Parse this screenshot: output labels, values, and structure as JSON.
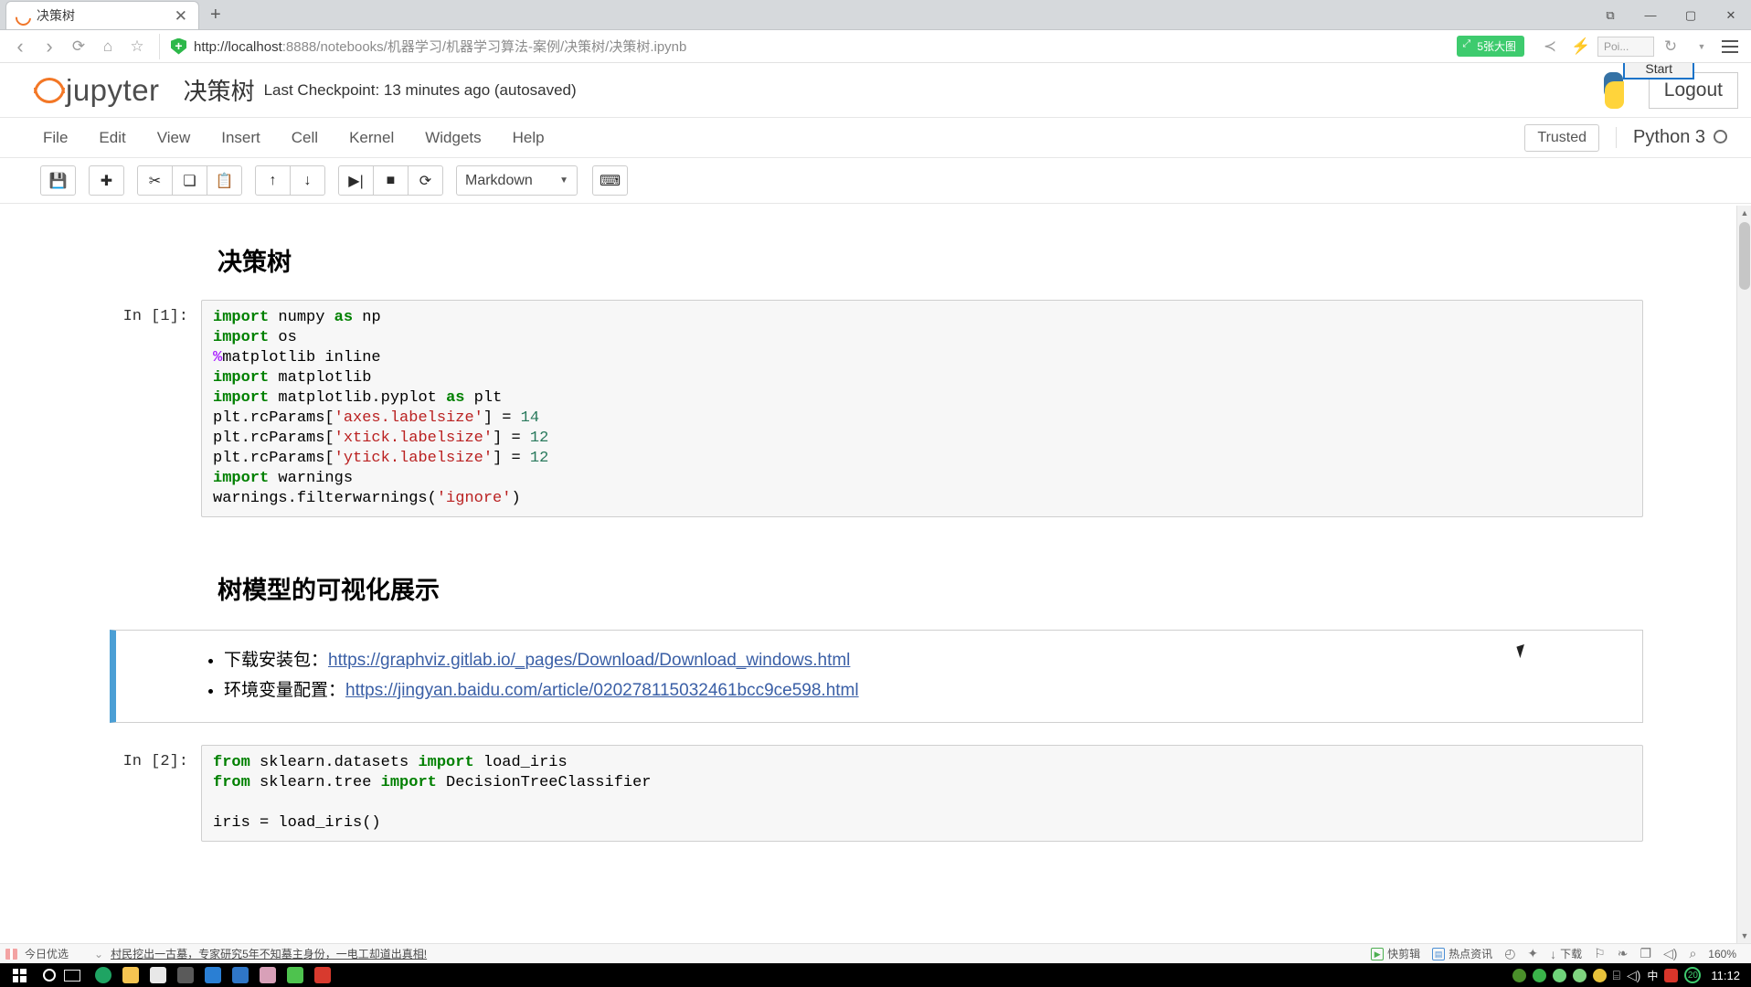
{
  "browser": {
    "tab": {
      "title": "决策树",
      "close_label": "✕",
      "favicon": "jupyter-favicon"
    },
    "new_tab_label": "+",
    "window_controls": [
      {
        "name": "restore-session-button",
        "glyph": "⧉"
      },
      {
        "name": "minimize-button",
        "glyph": "—"
      },
      {
        "name": "maximize-button",
        "glyph": "▢"
      },
      {
        "name": "close-button",
        "glyph": "✕"
      }
    ],
    "nav": {
      "back": "‹",
      "forward": "›",
      "reload": "⟳",
      "home": "⌂",
      "bookmark": "☆"
    },
    "url_protocol": "http://",
    "url_host": "localhost",
    "url_path": ":8888/notebooks/机器学习/机器学习算法-案例/决策树/决策树.ipynb",
    "url_full": "http://localhost:8888/notebooks/机器学习/机器学习算法-案例/决策树/决策树.ipynb",
    "image_badge": "5张大图",
    "share_icon": "≺",
    "bolt_icon": "⚡",
    "poi_box_text": "Poi...",
    "history_icon": "↻",
    "menu_icon": "hamburger-menu"
  },
  "jupyter": {
    "logo_text": "jupyter",
    "notebook_name": "决策树",
    "checkpoint": "Last Checkpoint: 13 minutes ago (autosaved)",
    "start_tooltip": "Start",
    "logout_label": "Logout",
    "trusted_label": "Trusted",
    "kernel_label": "Python 3",
    "menus": [
      {
        "label": "File"
      },
      {
        "label": "Edit"
      },
      {
        "label": "View"
      },
      {
        "label": "Insert"
      },
      {
        "label": "Cell"
      },
      {
        "label": "Kernel"
      },
      {
        "label": "Widgets"
      },
      {
        "label": "Help"
      }
    ],
    "toolbar": {
      "save": "💾",
      "insert_below": "✚",
      "cut": "✂",
      "copy": "❏",
      "paste": "📋",
      "move_up": "↑",
      "move_down": "↓",
      "run": "▶|",
      "stop": "■",
      "restart": "⟳",
      "cell_type": "Markdown",
      "cell_type_caret": "▼",
      "command_palette": "⌨"
    }
  },
  "notebook": {
    "heading_1": "决策树",
    "heading_2": "树模型的可视化展示",
    "cell_1": {
      "prompt": "In [1]:",
      "lines": [
        [
          {
            "t": "import",
            "c": "k"
          },
          {
            "t": " numpy ",
            "c": ""
          },
          {
            "t": "as",
            "c": "k"
          },
          {
            "t": " np",
            "c": ""
          }
        ],
        [
          {
            "t": "import",
            "c": "k"
          },
          {
            "t": " os",
            "c": ""
          }
        ],
        [
          {
            "t": "%",
            "c": "m"
          },
          {
            "t": "matplotlib inline",
            "c": ""
          }
        ],
        [
          {
            "t": "import",
            "c": "k"
          },
          {
            "t": " matplotlib",
            "c": ""
          }
        ],
        [
          {
            "t": "import",
            "c": "k"
          },
          {
            "t": " matplotlib.pyplot ",
            "c": ""
          },
          {
            "t": "as",
            "c": "k"
          },
          {
            "t": " plt",
            "c": ""
          }
        ],
        [
          {
            "t": "plt.rcParams[",
            "c": ""
          },
          {
            "t": "'axes.labelsize'",
            "c": "s"
          },
          {
            "t": "] = ",
            "c": ""
          },
          {
            "t": "14",
            "c": "n"
          }
        ],
        [
          {
            "t": "plt.rcParams[",
            "c": ""
          },
          {
            "t": "'xtick.labelsize'",
            "c": "s"
          },
          {
            "t": "] = ",
            "c": ""
          },
          {
            "t": "12",
            "c": "n"
          }
        ],
        [
          {
            "t": "plt.rcParams[",
            "c": ""
          },
          {
            "t": "'ytick.labelsize'",
            "c": "s"
          },
          {
            "t": "] = ",
            "c": ""
          },
          {
            "t": "12",
            "c": "n"
          }
        ],
        [
          {
            "t": "import",
            "c": "k"
          },
          {
            "t": " warnings",
            "c": ""
          }
        ],
        [
          {
            "t": "warnings.filterwarnings(",
            "c": ""
          },
          {
            "t": "'ignore'",
            "c": "s"
          },
          {
            "t": ")",
            "c": ""
          }
        ]
      ]
    },
    "alert": {
      "items": [
        {
          "label": "下载安装包：",
          "link": "https://graphviz.gitlab.io/_pages/Download/Download_windows.html"
        },
        {
          "label": "环境变量配置：",
          "link": "https://jingyan.baidu.com/article/020278115032461bcc9ce598.html"
        }
      ]
    },
    "cell_2": {
      "prompt": "In [2]:",
      "lines": [
        [
          {
            "t": "from",
            "c": "k"
          },
          {
            "t": " sklearn.datasets ",
            "c": ""
          },
          {
            "t": "import",
            "c": "k"
          },
          {
            "t": " load_iris",
            "c": ""
          }
        ],
        [
          {
            "t": "from",
            "c": "k"
          },
          {
            "t": " sklearn.tree ",
            "c": ""
          },
          {
            "t": "import",
            "c": "k"
          },
          {
            "t": " DecisionTreeClassifier",
            "c": ""
          }
        ],
        [
          {
            "t": "",
            "c": ""
          }
        ],
        [
          {
            "t": "iris = load_iris()",
            "c": ""
          }
        ]
      ]
    }
  },
  "statusbar": {
    "gift_label": "今日优选",
    "collapse_icon": "⌄",
    "news": "村民挖出一古墓，专家研究5年不知墓主身份，一电工却道出真相!",
    "items": [
      {
        "label": "快剪辑",
        "icon": "scissors-icon"
      },
      {
        "label": "热点资讯",
        "icon": "news-icon"
      },
      {
        "label": "",
        "icon": "speedometer-icon"
      },
      {
        "label": "",
        "icon": "rocket-icon"
      },
      {
        "label": "下载",
        "icon": "download-icon"
      },
      {
        "label": "",
        "icon": "flag-icon"
      },
      {
        "label": "",
        "icon": "leaf-icon"
      },
      {
        "label": "",
        "icon": "window-icon"
      },
      {
        "label": "",
        "icon": "speaker-icon"
      },
      {
        "label": "",
        "icon": "search-icon"
      }
    ],
    "zoom": "160%"
  },
  "taskbar": {
    "start_icon": "windows-start-icon",
    "cortana_icon": "cortana-circle-icon",
    "taskview_icon": "task-view-icon",
    "apps": [
      {
        "name": "edge",
        "color": "#1fa463"
      },
      {
        "name": "file-explorer",
        "color": "#f5c451"
      },
      {
        "name": "news-app",
        "color": "#e8e8e8"
      },
      {
        "name": "terminal",
        "color": "#5a5a5a"
      },
      {
        "name": "excel-like",
        "color": "#2a7fd4"
      },
      {
        "name": "checkmark-app",
        "color": "#2f76c7"
      },
      {
        "name": "photos-app",
        "color": "#d8a0b8"
      },
      {
        "name": "wechat-app",
        "color": "#4ec34e"
      },
      {
        "name": "active-app",
        "color": "#d83a2e"
      }
    ],
    "tray": [
      {
        "name": "nvidia",
        "color": "#4a8f2a"
      },
      {
        "name": "browser-green",
        "color": "#3ab34a"
      },
      {
        "name": "wechat",
        "color": "#6fd37a"
      },
      {
        "name": "security-shield",
        "color": "#7fd37f"
      },
      {
        "name": "update",
        "color": "#e8c23a"
      },
      {
        "name": "network",
        "color": "#dedede"
      },
      {
        "name": "volume",
        "color": "#dedede"
      }
    ],
    "ime": "中",
    "sogou": "S",
    "battery_badge": "20",
    "clock": "11:12"
  }
}
